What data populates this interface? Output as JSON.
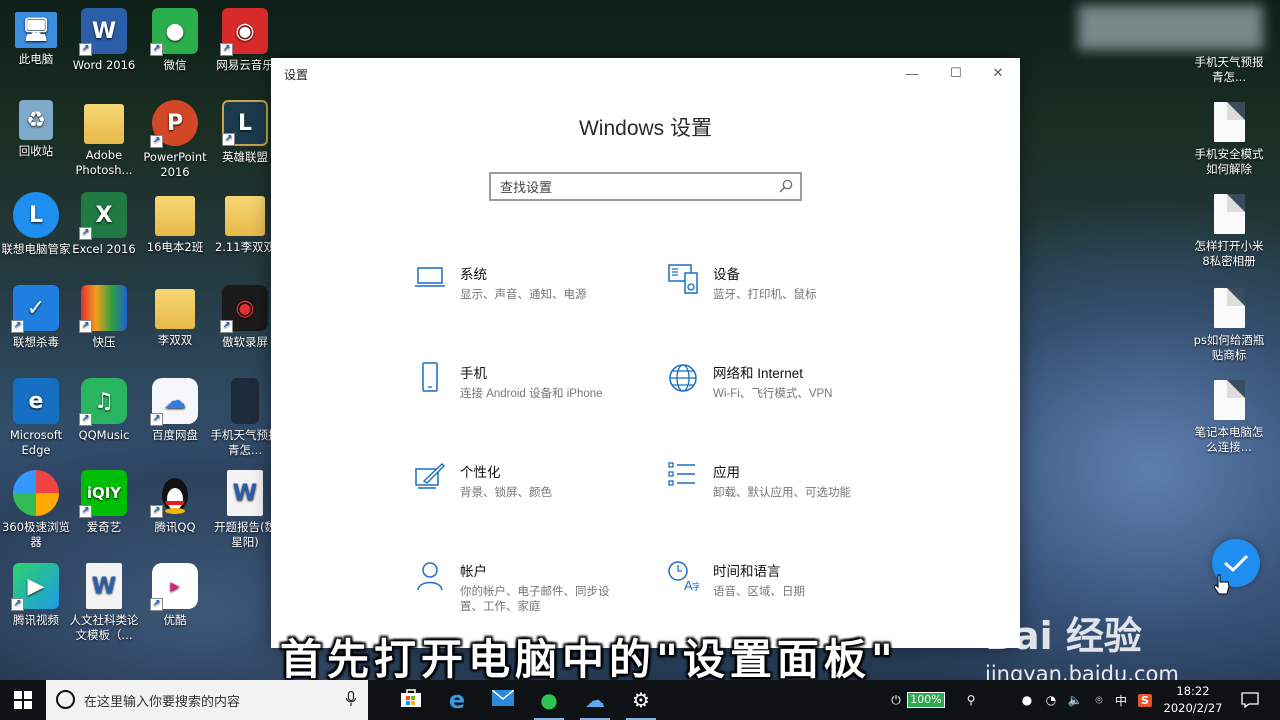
{
  "desktop": {
    "icons": [
      {
        "label": "此电脑"
      },
      {
        "label": "Word 2016"
      },
      {
        "label": "微信"
      },
      {
        "label": "网易云音乐"
      },
      {
        "label": "回收站"
      },
      {
        "label": "Adobe Photosh..."
      },
      {
        "label": "PowerPoint 2016"
      },
      {
        "label": "英雄联盟"
      },
      {
        "label": "联想电脑管家"
      },
      {
        "label": "Excel 2016"
      },
      {
        "label": "16电本2班"
      },
      {
        "label": "2.11李双双"
      },
      {
        "label": "联想杀毒"
      },
      {
        "label": "快压"
      },
      {
        "label": "李双双"
      },
      {
        "label": "傲软录屏"
      },
      {
        "label": "Microsoft Edge"
      },
      {
        "label": "QQMusic"
      },
      {
        "label": "百度网盘"
      },
      {
        "label": "手机天气预报青怎..."
      },
      {
        "label": "360极速浏览器"
      },
      {
        "label": "爱奇艺"
      },
      {
        "label": "腾讯QQ"
      },
      {
        "label": "开题报告(魏星阳)"
      },
      {
        "label": "腾讯视频"
      },
      {
        "label": "人文社科类论文模板（..."
      },
      {
        "label": "优酷"
      }
    ],
    "right_icons": [
      {
        "label": "手机天气预报青怎..."
      },
      {
        "label": "手机安全模式如何解除"
      },
      {
        "label": "怎样打开小米8私密相册"
      },
      {
        "label": "ps如何给酒瓶贴商标"
      },
      {
        "label": "笔记本电脑怎么连接..."
      }
    ]
  },
  "window": {
    "title": "设置",
    "minimize": "—",
    "maximize": "☐",
    "close": "✕",
    "heading": "Windows 设置",
    "search_placeholder": "查找设置",
    "categories": [
      {
        "title": "系统",
        "desc": "显示、声音、通知、电源",
        "icon": "laptop-icon"
      },
      {
        "title": "设备",
        "desc": "蓝牙、打印机、鼠标",
        "icon": "devices-icon"
      },
      {
        "title": "手机",
        "desc": "连接 Android 设备和 iPhone",
        "icon": "phone-icon"
      },
      {
        "title": "网络和 Internet",
        "desc": "Wi-Fi、飞行模式、VPN",
        "icon": "globe-icon"
      },
      {
        "title": "个性化",
        "desc": "背景、锁屏、颜色",
        "icon": "paint-icon"
      },
      {
        "title": "应用",
        "desc": "卸载、默认应用、可选功能",
        "icon": "apps-list-icon"
      },
      {
        "title": "帐户",
        "desc": "你的帐户、电子邮件、同步设置、工作、家庭",
        "icon": "person-icon"
      },
      {
        "title": "时间和语言",
        "desc": "语音、区域、日期",
        "icon": "time-language-icon"
      }
    ]
  },
  "overlay": {
    "subtitle": "首先打开电脑中的\"设置面板\"",
    "watermark_logo": "Bai 经验",
    "watermark_url": "jingyan.baidu.com"
  },
  "taskbar": {
    "search_placeholder": "在这里输入你要搜索的内容",
    "battery": "100%",
    "ime": "中",
    "time": "18:22",
    "date": "2020/2/27"
  },
  "colors": {
    "accent": "#1a6fc4",
    "taskbar": "#0f1215",
    "window_bg": "#ffffff"
  }
}
